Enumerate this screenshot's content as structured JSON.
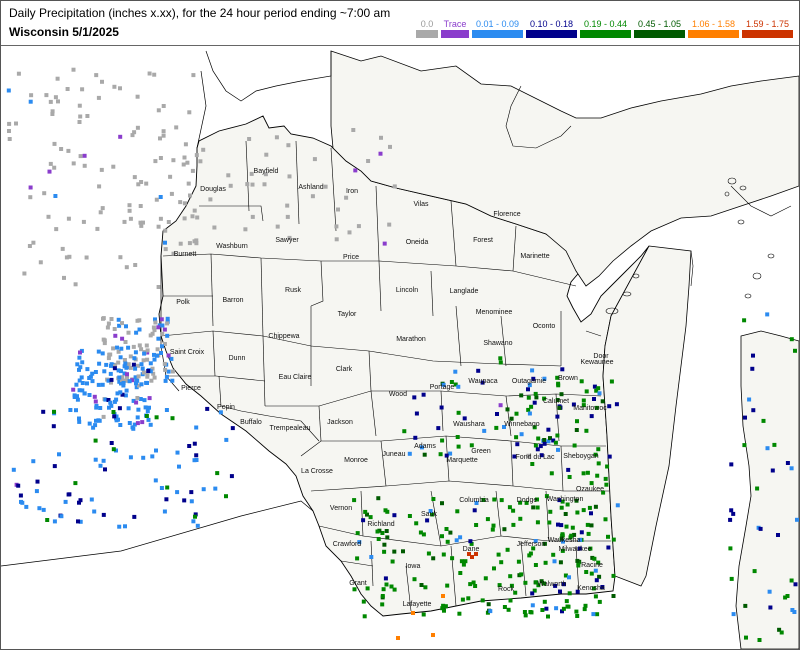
{
  "header": {
    "title": "Daily Precipitation (inches  x.xx),  for the 24 hour period ending ~7:00 am",
    "subtitle": "Wisconsin 5/1/2025"
  },
  "legend": [
    {
      "label": "0.0",
      "color": "#a9a9a9"
    },
    {
      "label": "Trace",
      "color": "#8a3dcc"
    },
    {
      "label": "0.01 - 0.09",
      "color": "#2b8bf0"
    },
    {
      "label": "0.10 - 0.18",
      "color": "#00008b"
    },
    {
      "label": "0.19 - 0.44",
      "color": "#008800"
    },
    {
      "label": "0.45 - 1.05",
      "color": "#005a00"
    },
    {
      "label": "1.06 - 1.58",
      "color": "#ff7f00"
    },
    {
      "label": "1.59 - 1.75",
      "color": "#cc3300"
    }
  ],
  "counties": [
    "Douglas",
    "Bayfield",
    "Ashland",
    "Iron",
    "Vilas",
    "Florence",
    "Forest",
    "Oneida",
    "Price",
    "Sawyer",
    "Washburn",
    "Burnett",
    "Marinette",
    "Langlade",
    "Lincoln",
    "Rusk",
    "Barron",
    "Polk",
    "Menominee",
    "Oconto",
    "Taylor",
    "Chippewa",
    "Saint Croix",
    "Dunn",
    "Marathon",
    "Shawano",
    "Door",
    "Kewaunee",
    "Eau Claire",
    "Pierce",
    "Clark",
    "Wood",
    "Portage",
    "Waupaca",
    "Outagamie",
    "Brown",
    "Calumet",
    "Manitowoc",
    "Pepin",
    "Buffalo",
    "Trempealeau",
    "Jackson",
    "Waushara",
    "Winnebago",
    "Green",
    "Fond du Lac",
    "Sheboygan",
    "Juneau",
    "Adams",
    "Marquette",
    "Monroe",
    "La Crosse",
    "Ozaukee",
    "Columbia",
    "Dodge",
    "Washington",
    "Vernon",
    "Sauk",
    "Richland",
    "Waukesha",
    "Jefferson",
    "Dane",
    "Crawford",
    "Milwaukee",
    "Iowa",
    "Racine",
    "Grant",
    "Walworth",
    "Rock",
    "Kenosha",
    "Lafayette"
  ]
}
